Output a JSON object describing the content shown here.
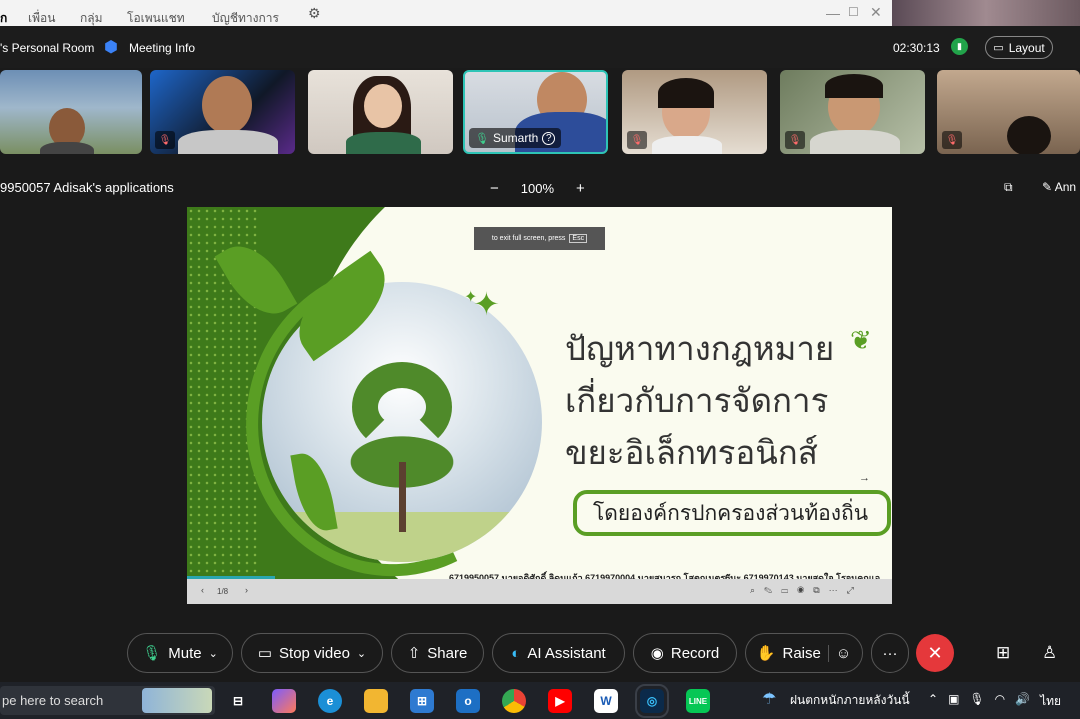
{
  "background_app": {
    "tabs": [
      "เพื่อน",
      "กลุ่ม",
      "โอเพนแชท",
      "บัญชีทางการ"
    ]
  },
  "meeting": {
    "room_name": "'s Personal Room",
    "info_label": "Meeting Info",
    "timer": "02:30:13",
    "layout_label": "Layout"
  },
  "participants": [
    {
      "name": "",
      "muted": false
    },
    {
      "name": "",
      "muted": true
    },
    {
      "name": "",
      "muted": false
    },
    {
      "name": "Sumarth",
      "muted": false,
      "active": true
    },
    {
      "name": "",
      "muted": true
    },
    {
      "name": "",
      "muted": true
    },
    {
      "name": "",
      "muted": true
    }
  ],
  "share": {
    "title": "9950057 Adisak's applications",
    "zoom": "100%",
    "zoom_minus": "−",
    "zoom_plus": "+",
    "annotate_label": "Ann"
  },
  "slide": {
    "title_line1": "ปัญหาทางกฎหมาย",
    "title_line2": "เกี่ยวกับการจัดการ",
    "title_line3": "ขยะอิเล็กทรอนิกส์",
    "subtitle": "โดยองค์กรปกครองส่วนท้องถิ่น",
    "credit": "6719950057 นายอดิศักดิ์ ลิดนแก้ว 6719970004 นายสุนารถ โสตถเนตร6ันะ 6719970143 นายสุดใจ โรจนคูณเอ",
    "esc_hint": "to exit full screen, press",
    "esc_key": "Esc",
    "page_indicator": "1/8",
    "progress_fraction": 0.125
  },
  "controls": {
    "mute": "Mute",
    "stop_video": "Stop video",
    "share": "Share",
    "ai_assistant": "AI Assistant",
    "record": "Record",
    "raise": "Raise",
    "more": "···"
  },
  "taskbar": {
    "search_placeholder": "pe here to search",
    "weather": "ฝนตกหนักภายหลังวันนี้",
    "language": "ไทย"
  },
  "colors": {
    "accent_teal": "#2ec4b6",
    "end_red": "#e5383b",
    "slide_green": "#5a9e24"
  }
}
